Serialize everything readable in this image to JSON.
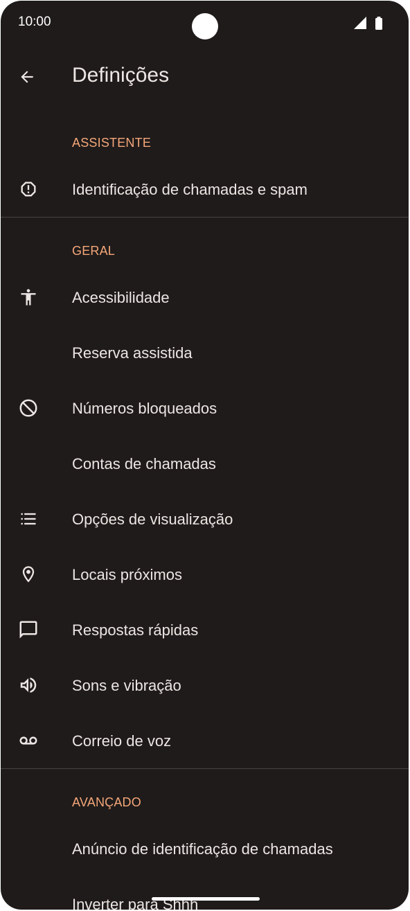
{
  "status_bar": {
    "time": "10:00",
    "icons": [
      "cellular-signal-icon",
      "battery-icon"
    ]
  },
  "app_bar": {
    "title": "Definições",
    "back_icon": "arrow-back-icon"
  },
  "sections": [
    {
      "header": "ASSISTENTE",
      "items": [
        {
          "label": "Identificação de chamadas e spam",
          "icon": "alert-octagon-icon"
        }
      ]
    },
    {
      "header": "GERAL",
      "items": [
        {
          "label": "Acessibilidade",
          "icon": "accessibility-icon"
        },
        {
          "label": "Reserva assistida",
          "icon": ""
        },
        {
          "label": "Números bloqueados",
          "icon": "block-icon"
        },
        {
          "label": "Contas de chamadas",
          "icon": ""
        },
        {
          "label": "Opções de visualização",
          "icon": "list-icon"
        },
        {
          "label": "Locais próximos",
          "icon": "location-pin-icon"
        },
        {
          "label": "Respostas rápidas",
          "icon": "chat-bubble-icon"
        },
        {
          "label": "Sons e vibração",
          "icon": "volume-icon"
        },
        {
          "label": "Correio de voz",
          "icon": "voicemail-icon"
        }
      ]
    },
    {
      "header": "AVANÇADO",
      "items": [
        {
          "label": "Anúncio de identificação de chamadas",
          "icon": ""
        },
        {
          "label": "Inverter para Shhh",
          "icon": ""
        }
      ]
    }
  ],
  "colors": {
    "background": "#1f1b1a",
    "accent": "#f5a77a",
    "text": "#ece6e4",
    "divider": "#4a4442"
  }
}
